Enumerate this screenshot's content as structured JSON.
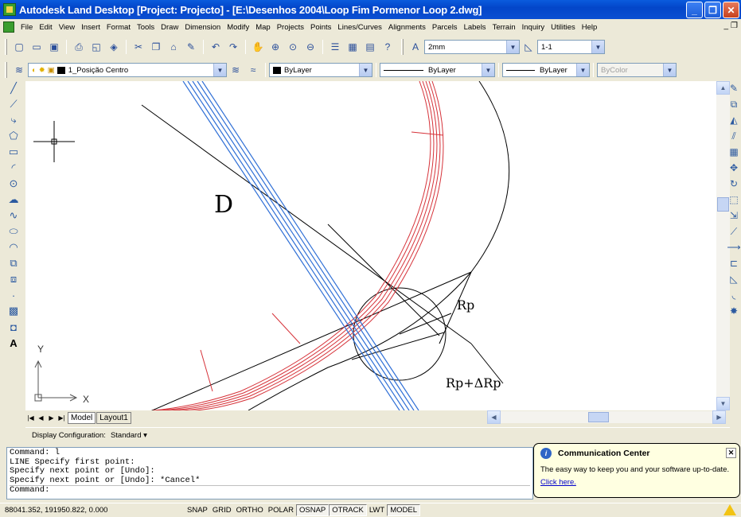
{
  "window": {
    "title": "Autodesk Land Desktop [Project: Projecto] - [E:\\Desenhos 2004\\Loop Fim Pormenor Loop 2.dwg]",
    "minimize": "_",
    "maximize": "❐",
    "close": "✕"
  },
  "menu": {
    "items": [
      "File",
      "Edit",
      "View",
      "Insert",
      "Format",
      "Tools",
      "Draw",
      "Dimension",
      "Modify",
      "Map",
      "Projects",
      "Points",
      "Lines/Curves",
      "Alignments",
      "Parcels",
      "Labels",
      "Terrain",
      "Inquiry",
      "Utilities",
      "Help"
    ],
    "mdi_min": "_",
    "mdi_restore": "❐"
  },
  "toolbar": {
    "text_height": "2mm",
    "scale": "1-1"
  },
  "layers": {
    "current_layer": "1_Posição Centro",
    "color": "ByLayer",
    "linetype": "ByLayer",
    "lineweight": "ByLayer",
    "plot_style": "ByColor"
  },
  "drawing": {
    "annotations": {
      "d": "D",
      "rp": "Rp",
      "rp_delta": "Rp+ΔRp"
    },
    "ucs": {
      "x": "X",
      "y": "Y"
    }
  },
  "tabs": {
    "model": "Model",
    "layout1": "Layout1"
  },
  "display_config": {
    "label": "Display Configuration:",
    "value": "Standard ▾"
  },
  "command": {
    "lines": [
      "Command: l",
      "LINE Specify first point:",
      "Specify next point or [Undo]:",
      "Specify next point or [Undo]: *Cancel*"
    ],
    "prompt": "Command:"
  },
  "balloon": {
    "title": "Communication Center",
    "message": "The easy way to keep you and your software up-to-date.",
    "link": "Click here.",
    "close": "✕",
    "info_glyph": "i"
  },
  "status": {
    "coordinates": "88041.352, 191950.822, 0.000",
    "toggles": [
      {
        "label": "SNAP",
        "on": false
      },
      {
        "label": "GRID",
        "on": false
      },
      {
        "label": "ORTHO",
        "on": false
      },
      {
        "label": "POLAR",
        "on": false
      },
      {
        "label": "OSNAP",
        "on": true
      },
      {
        "label": "OTRACK",
        "on": true
      },
      {
        "label": "LWT",
        "on": false
      },
      {
        "label": "MODEL",
        "on": true
      }
    ]
  },
  "colors": {
    "title_bar": "#0A5BDD",
    "road_red": "#D6333A",
    "road_blue": "#2F6FD6",
    "canvas": "#FFFFFF"
  }
}
